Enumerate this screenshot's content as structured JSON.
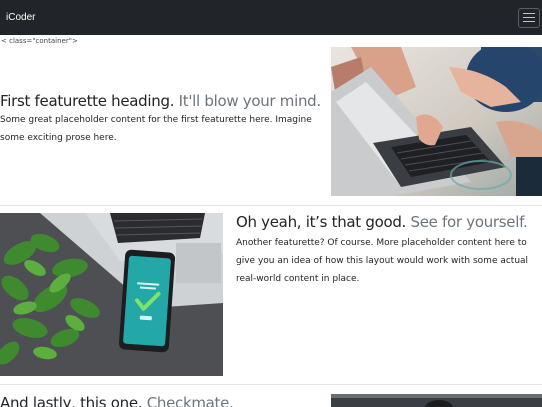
{
  "navbar": {
    "brand": "iCoder",
    "toggler_icon": "hamburger-icon"
  },
  "stray_markup": "< class=\"container\">",
  "featurettes": [
    {
      "heading": "First featurette heading.",
      "heading_muted": "It'll blow your mind.",
      "text": "Some great placeholder content for the first featurette here. Imagine some exciting prose here.",
      "image": "laptop-hands-photo"
    },
    {
      "heading": "Oh yeah, it’s that good.",
      "heading_muted": "See for yourself.",
      "text": "Another featurette? Of course. More placeholder content here to give you an idea of how this layout would work with some actual real-world content in place.",
      "image": "phone-plant-photo"
    },
    {
      "heading": "And lastly, this one.",
      "heading_muted": "Checkmate.",
      "text": "",
      "image": "third-photo"
    }
  ],
  "colors": {
    "navbar": "#212529",
    "text": "#212529",
    "muted": "#6c757d",
    "divider": "#e3e5e8"
  }
}
